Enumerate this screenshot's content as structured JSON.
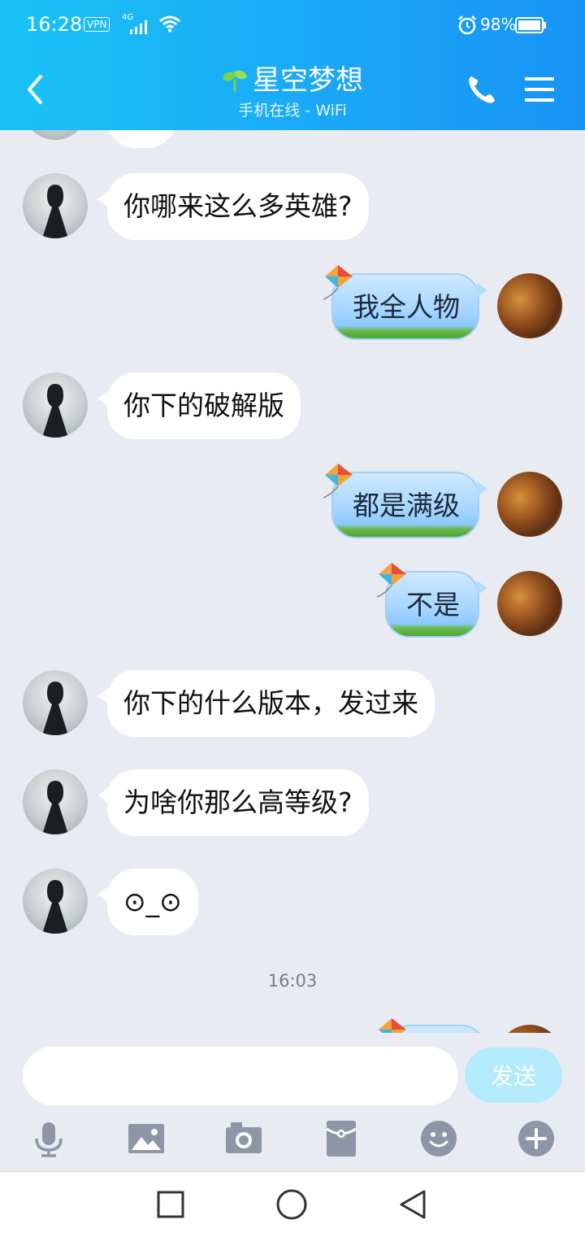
{
  "status_bar": {
    "time": "16:28",
    "vpn": "VPN",
    "network": "4G",
    "battery": "98%"
  },
  "header": {
    "title": "星空梦想",
    "subtitle": "手机在线 - WiFi"
  },
  "messages": [
    {
      "side": "left",
      "text": "你哪来这么多英雄?"
    },
    {
      "side": "right",
      "text": "我全人物"
    },
    {
      "side": "left",
      "text": "你下的破解版"
    },
    {
      "side": "right",
      "text": "都是满级"
    },
    {
      "side": "right",
      "text": "不是"
    },
    {
      "side": "left",
      "text": "你下的什么版本，发过来"
    },
    {
      "side": "left",
      "text": "为啥你那么高等级?"
    },
    {
      "side": "left",
      "text": "⊙_⊙"
    }
  ],
  "timestamp": "16:03",
  "composer": {
    "placeholder": "",
    "send_label": "发送"
  },
  "toolbar_icons": [
    "microphone-icon",
    "image-icon",
    "camera-icon",
    "red-packet-icon",
    "emoji-icon",
    "plus-icon"
  ],
  "nav_icons": [
    "recents-square-icon",
    "home-circle-icon",
    "back-triangle-icon"
  ],
  "colors": {
    "header_gradient_start": "#19c3f6",
    "header_gradient_end": "#1793f5",
    "background": "#e9ebf2",
    "send_button": "#b3eafc",
    "toolbar_icon": "#8e95a6"
  }
}
